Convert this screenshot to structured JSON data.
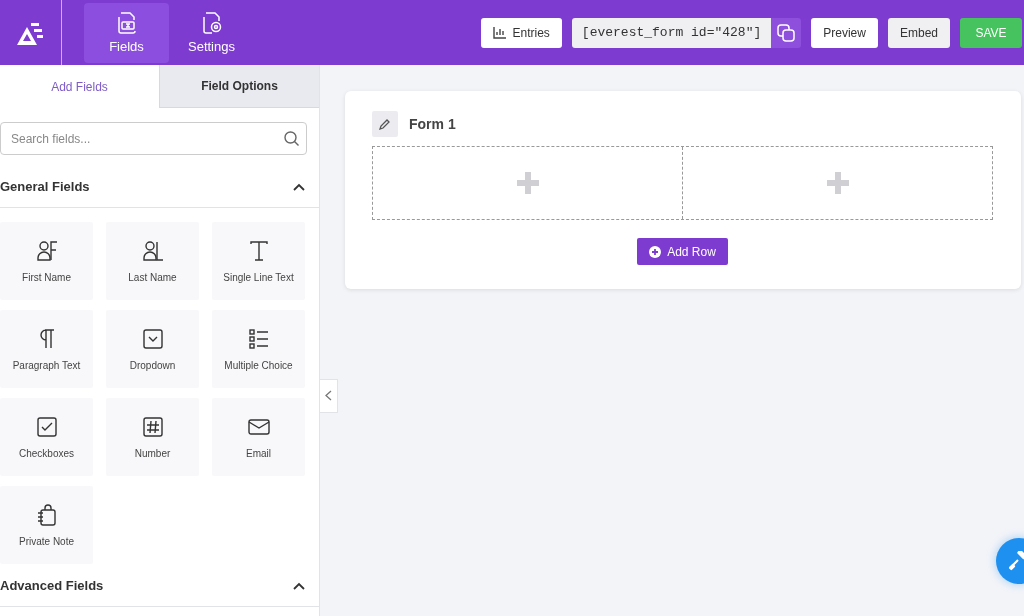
{
  "header_tabs": [
    {
      "label": "Fields",
      "kind": "fields",
      "selected": true
    },
    {
      "label": "Settings",
      "kind": "settings",
      "selected": false
    }
  ],
  "toolbar": {
    "entries": "Entries",
    "shortcode": "[everest_form id=\"428\"]",
    "preview": "Preview",
    "embed": "Embed",
    "save": "SAVE"
  },
  "sidebar_tabs": [
    {
      "label": "Add Fields",
      "selected": true
    },
    {
      "label": "Field Options",
      "selected": false
    }
  ],
  "search": {
    "placeholder": "Search fields..."
  },
  "sections": [
    {
      "title": "General Fields",
      "expanded": true,
      "fields": [
        {
          "label": "First Name",
          "kind": "first-name"
        },
        {
          "label": "Last Name",
          "kind": "last-name"
        },
        {
          "label": "Single Line Text",
          "kind": "text"
        },
        {
          "label": "Paragraph Text",
          "kind": "paragraph"
        },
        {
          "label": "Dropdown",
          "kind": "dropdown"
        },
        {
          "label": "Multiple Choice",
          "kind": "choice"
        },
        {
          "label": "Checkboxes",
          "kind": "checkbox"
        },
        {
          "label": "Number",
          "kind": "number"
        },
        {
          "label": "Email",
          "kind": "email"
        },
        {
          "label": "Private Note",
          "kind": "note"
        }
      ]
    },
    {
      "title": "Advanced Fields",
      "expanded": true
    }
  ],
  "form": {
    "title": "Form 1",
    "add_row": "Add Row"
  }
}
